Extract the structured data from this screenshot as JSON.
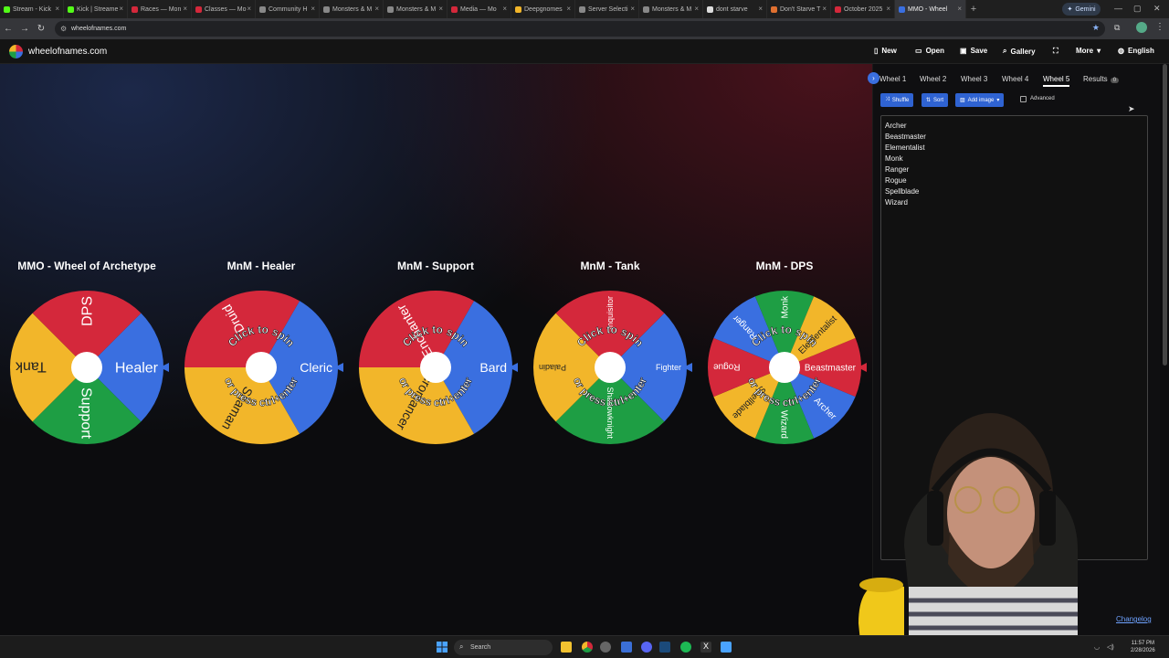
{
  "browser": {
    "tabs": [
      {
        "label": "Stream - Kick",
        "color": "#53fc18"
      },
      {
        "label": "Kick | Streame",
        "color": "#53fc18"
      },
      {
        "label": "Races — Mon",
        "color": "#d4283b"
      },
      {
        "label": "Classes — Mo",
        "color": "#d4283b"
      },
      {
        "label": "Community H",
        "color": "#888888"
      },
      {
        "label": "Monsters & M",
        "color": "#888888"
      },
      {
        "label": "Monsters & M",
        "color": "#888888"
      },
      {
        "label": "Media — Mo",
        "color": "#d4283b"
      },
      {
        "label": "Deepgnomes",
        "color": "#f2b62a"
      },
      {
        "label": "Server Selecti",
        "color": "#888888"
      },
      {
        "label": "Monsters & M",
        "color": "#888888"
      },
      {
        "label": "dont starve",
        "color": "#dddddd"
      },
      {
        "label": "Don't Starve T",
        "color": "#e07030"
      },
      {
        "label": "October 2025",
        "color": "#d4283b"
      },
      {
        "label": "MMO - Wheel",
        "color": "#3a6fe0"
      }
    ],
    "gemini_label": "Gemini",
    "url": "wheelofnames.com"
  },
  "app": {
    "brand": "wheelofnames.com",
    "menu": [
      {
        "label": "New",
        "icon": "file-icon"
      },
      {
        "label": "Open",
        "icon": "folder-icon"
      },
      {
        "label": "Save",
        "icon": "save-icon"
      },
      {
        "label": "Gallery",
        "icon": "search-icon"
      },
      {
        "label": "",
        "icon": "fullscreen-icon"
      },
      {
        "label": "More",
        "icon": "chevron-down-icon"
      },
      {
        "label": "English",
        "icon": "globe-icon"
      }
    ]
  },
  "wheels": [
    {
      "title": "MMO - Wheel of Archetype",
      "hub_text": false,
      "pointer": "#3a6fe0",
      "segments": [
        {
          "label": "Healer",
          "color": "#3a6fe0"
        },
        {
          "label": "Support",
          "color": "#1e9e44"
        },
        {
          "label": "Tank",
          "color": "#f2b62a"
        },
        {
          "label": "DPS",
          "color": "#d4283b"
        }
      ],
      "label_size": 16
    },
    {
      "title": "MnM - Healer",
      "hub_text": true,
      "pointer": "#3a6fe0",
      "segments": [
        {
          "label": "Cleric",
          "color": "#3a6fe0"
        },
        {
          "label": "Shaman",
          "color": "#f2b62a"
        },
        {
          "label": "Druid",
          "color": "#d4283b"
        }
      ],
      "label_size": 14
    },
    {
      "title": "MnM - Support",
      "hub_text": true,
      "pointer": "#3a6fe0",
      "segments": [
        {
          "label": "Bard",
          "color": "#3a6fe0"
        },
        {
          "label": "Necromancer",
          "color": "#f2b62a"
        },
        {
          "label": "Enchanter",
          "color": "#d4283b"
        }
      ],
      "label_size": 14
    },
    {
      "title": "MnM - Tank",
      "hub_text": true,
      "pointer": "#3a6fe0",
      "segments": [
        {
          "label": "Fighter",
          "color": "#3a6fe0"
        },
        {
          "label": "Shadowknight",
          "color": "#1e9e44"
        },
        {
          "label": "Paladin",
          "color": "#f2b62a"
        },
        {
          "label": "Inquisitor",
          "color": "#d4283b"
        }
      ],
      "label_size": 9
    },
    {
      "title": "MnM - DPS",
      "hub_text": true,
      "pointer": "#d4283b",
      "segments": [
        {
          "label": "Beastmaster",
          "color": "#d4283b"
        },
        {
          "label": "Archer",
          "color": "#3a6fe0"
        },
        {
          "label": "Wizard",
          "color": "#1e9e44"
        },
        {
          "label": "Spellblade",
          "color": "#f2b62a"
        },
        {
          "label": "Rogue",
          "color": "#d4283b"
        },
        {
          "label": "Ranger",
          "color": "#3a6fe0"
        },
        {
          "label": "Monk",
          "color": "#1e9e44"
        },
        {
          "label": "Elementalist",
          "color": "#f2b62a"
        }
      ],
      "label_size": 10
    }
  ],
  "hub": {
    "line1": "Click to spin",
    "line2": "or press ctrl+enter"
  },
  "panel": {
    "wheel_tabs": [
      "Wheel 1",
      "Wheel 2",
      "Wheel 3",
      "Wheel 4",
      "Wheel 5"
    ],
    "selected_tab": "Wheel 5",
    "results_label": "Results",
    "results_count": "0",
    "shuffle": "Shuffle",
    "sort": "Sort",
    "add_image": "Add image",
    "advanced": "Advanced",
    "entries": [
      "Archer",
      "Beastmaster",
      "Elementalist",
      "Monk",
      "Ranger",
      "Rogue",
      "Spellblade",
      "Wizard"
    ],
    "changelog": "Changelog"
  },
  "taskbar": {
    "search_placeholder": "Search",
    "time": "11:57 PM",
    "date": "2/28/2026"
  }
}
